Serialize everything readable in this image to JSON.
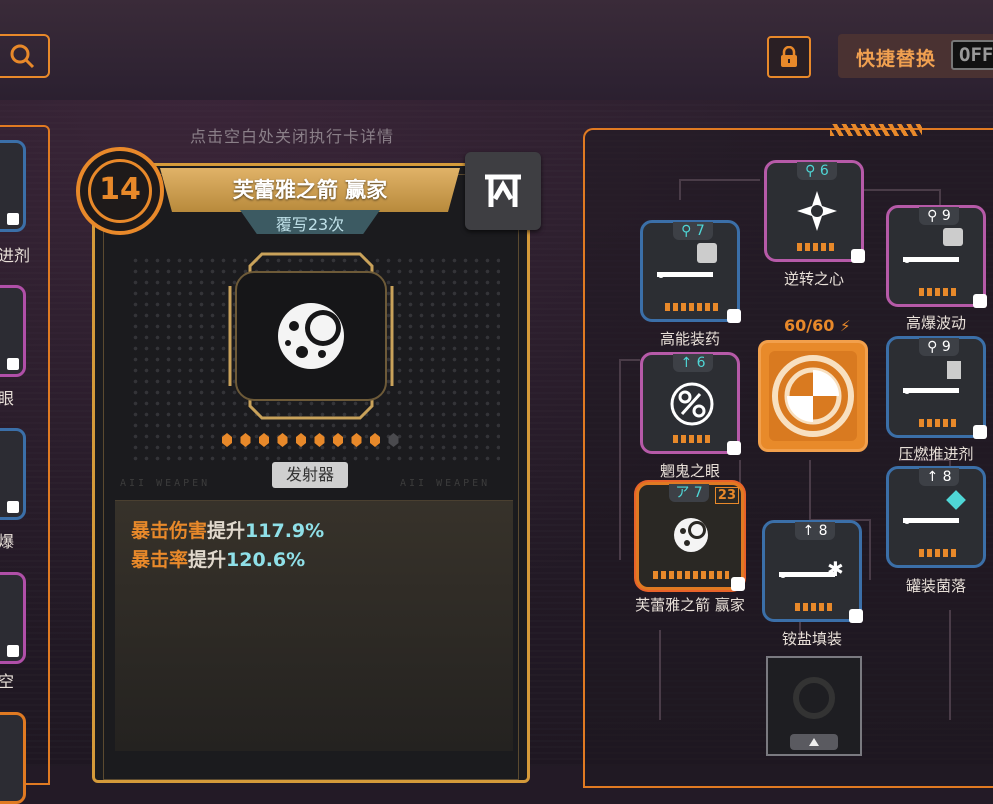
{
  "topbar": {
    "quick_swap_label": "快捷替换",
    "toggle_value": "OFF"
  },
  "hint": "点击空白处关闭执行卡详情",
  "left_column": {
    "labels": [
      "进剂",
      "眼",
      "爆",
      "空"
    ]
  },
  "detail": {
    "cost": "14",
    "title": "芙蕾雅之箭 赢家",
    "subtitle": "覆写23次",
    "type_tag": "发射器",
    "weapon_text_left": "AII WEAPEN",
    "weapon_text_right": "AII WEAPEN",
    "charges_filled": 9,
    "charges_total": 10,
    "stats": [
      {
        "key": "暴击伤害",
        "mid": "提升",
        "val": "117.9%"
      },
      {
        "key": "暴击率",
        "mid": "提升",
        "val": "120.6%"
      }
    ]
  },
  "board": {
    "energy": "60/60",
    "cards": [
      {
        "id": "gaoneng",
        "label": "高能装药",
        "level": "7",
        "icon": "pin-icon",
        "border": "blue"
      },
      {
        "id": "nizhuan",
        "label": "逆转之心",
        "level": "6",
        "icon": "pin-icon",
        "border": "purple"
      },
      {
        "id": "gaobao",
        "label": "高爆波动",
        "level": "9",
        "icon": "pin-icon",
        "border": "purple"
      },
      {
        "id": "meigui",
        "label": "魍鬼之眼",
        "level": "6",
        "icon": "arrow-up-icon",
        "border": "purple"
      },
      {
        "id": "yaran",
        "label": "压燃推进剂",
        "level": "9",
        "icon": "pin-icon",
        "border": "blue"
      },
      {
        "id": "fuleiya",
        "label": "芙蕾雅之箭 赢家",
        "level": "7",
        "badge": "23",
        "icon": "alpha-icon",
        "border": "orange"
      },
      {
        "id": "guanzhuang",
        "label": "罐装菌落",
        "level": "8",
        "icon": "arrow-up-icon",
        "border": "blue"
      },
      {
        "id": "nayan",
        "label": "铵盐填装",
        "level": "8",
        "icon": "arrow-up-icon",
        "border": "blue"
      }
    ]
  },
  "colors": {
    "accent": "#e8892a",
    "cyan": "#8fe0e8",
    "blue_border": "#3b6fa8",
    "purple_border": "#b65aa8"
  }
}
